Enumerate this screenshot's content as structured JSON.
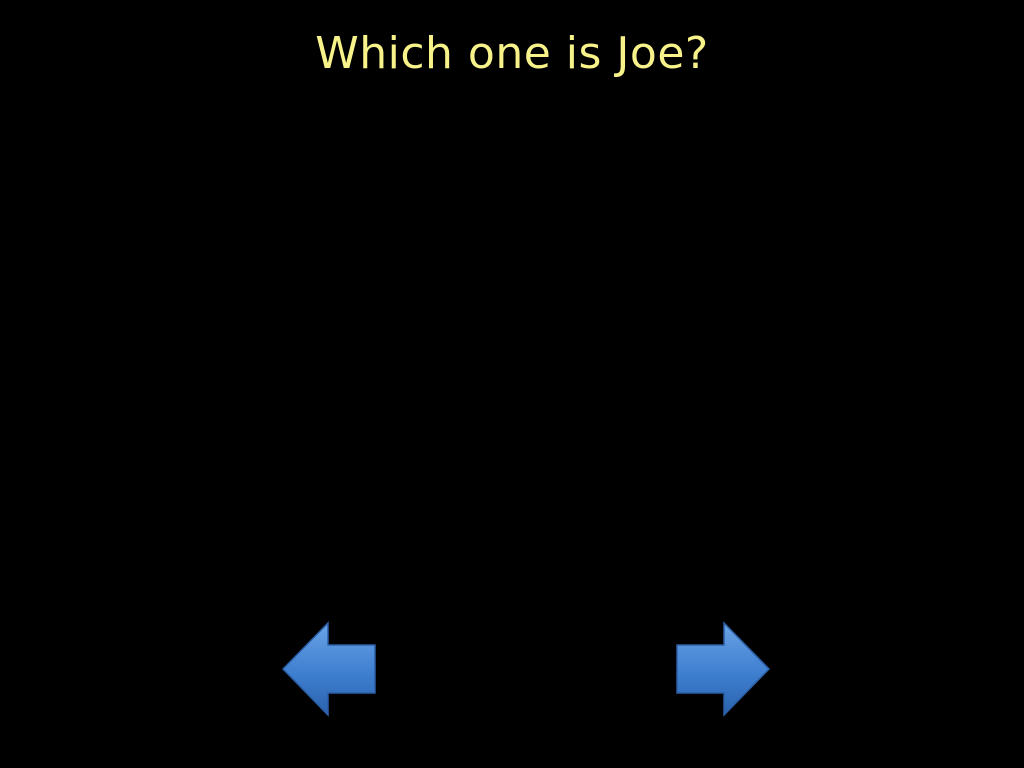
{
  "slide": {
    "title": "Which one is Joe?",
    "title_color": "#f7f38a",
    "background_color": "#000000"
  },
  "navigation": {
    "previous": {
      "icon": "left-arrow-icon",
      "color": "#3f7fd0"
    },
    "next": {
      "icon": "right-arrow-icon",
      "color": "#3f7fd0"
    }
  }
}
